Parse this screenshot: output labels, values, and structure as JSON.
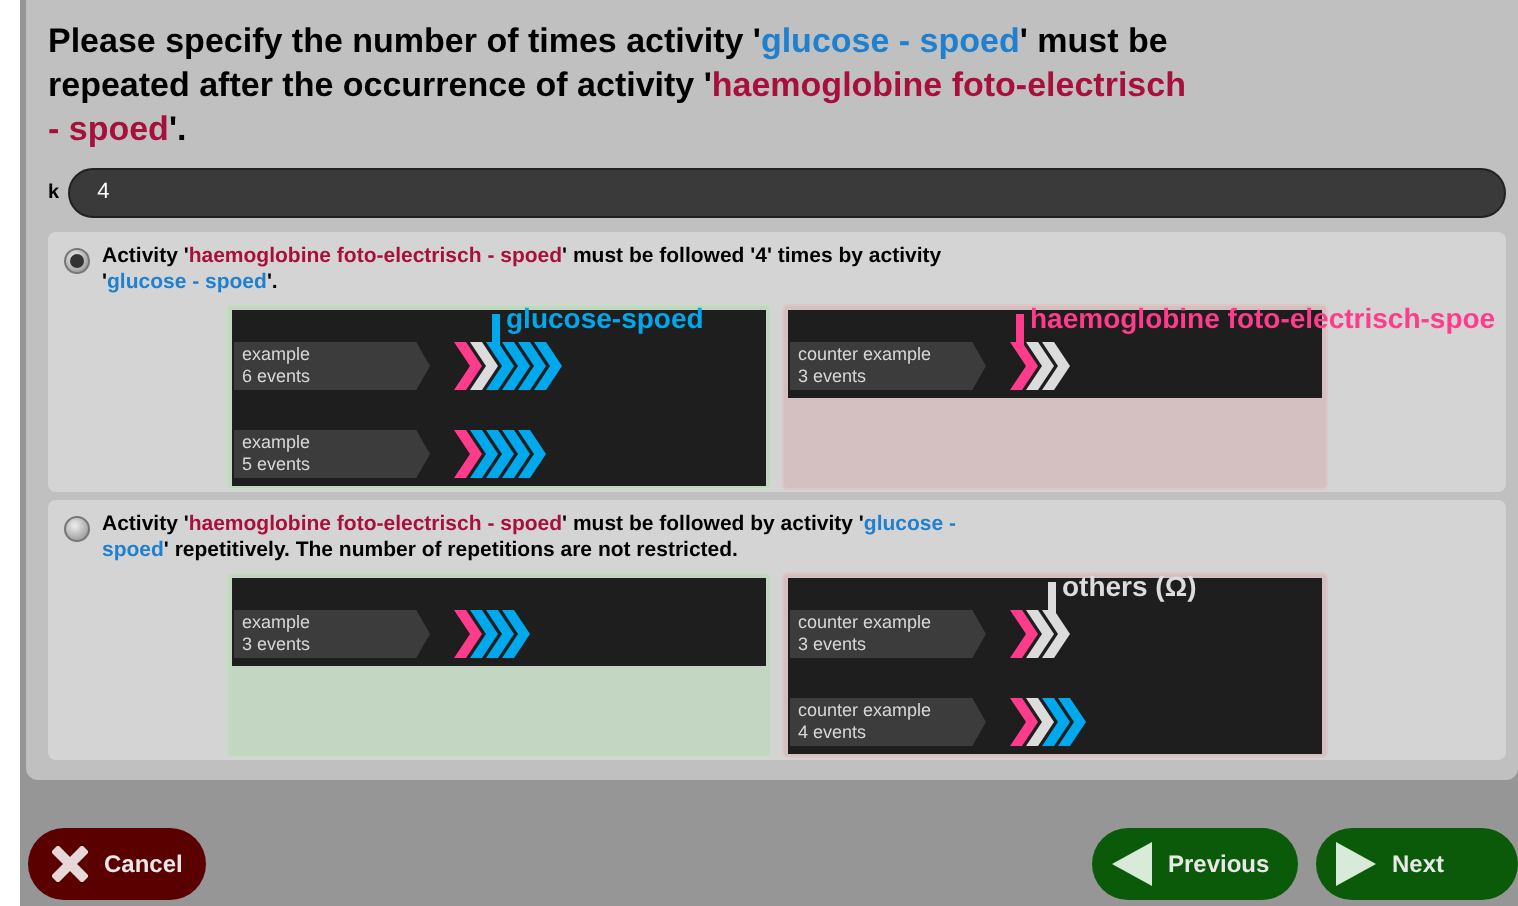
{
  "question": [
    {
      "kind": "plain",
      "text": "Please specify the number of times activity '"
    },
    {
      "kind": "target",
      "text": "glucose - spoed"
    },
    {
      "kind": "plain",
      "text": "' must be repeated after the occurrence of activity '"
    },
    {
      "kind": "source",
      "text": "haemoglobine foto-electrisch - spoed"
    },
    {
      "kind": "plain",
      "text": "'."
    }
  ],
  "field": {
    "label": "k",
    "value": "4"
  },
  "options": [
    {
      "selected": true,
      "sentence": [
        {
          "kind": "plain",
          "text": "Activity '"
        },
        {
          "kind": "source",
          "text": "haemoglobine foto-electrisch - spoed"
        },
        {
          "kind": "plain",
          "text": "' must be followed '4' times by activity '"
        },
        {
          "kind": "target",
          "text": "glucose - spoed"
        },
        {
          "kind": "plain",
          "text": "'."
        }
      ],
      "examples": [
        {
          "title": "example",
          "count": "6 events",
          "events": [
            {
              "kind": "source"
            },
            {
              "kind": "other"
            },
            {
              "kind": "target",
              "annotation": "glucose-spoed"
            },
            {
              "kind": "target"
            },
            {
              "kind": "target"
            },
            {
              "kind": "target"
            }
          ]
        },
        {
          "title": "example",
          "count": "5 events",
          "events": [
            {
              "kind": "source"
            },
            {
              "kind": "target"
            },
            {
              "kind": "target"
            },
            {
              "kind": "target"
            },
            {
              "kind": "target"
            }
          ]
        }
      ],
      "counter_examples": [
        {
          "title": "counter example",
          "count": "3 events",
          "events": [
            {
              "kind": "source",
              "annotation": "haemoglobine foto-electrisch-spoe"
            },
            {
              "kind": "other"
            },
            {
              "kind": "other"
            }
          ]
        }
      ]
    },
    {
      "selected": false,
      "sentence": [
        {
          "kind": "plain",
          "text": "Activity '"
        },
        {
          "kind": "source",
          "text": "haemoglobine foto-electrisch - spoed"
        },
        {
          "kind": "plain",
          "text": "' must be followed by activity '"
        },
        {
          "kind": "target",
          "text": "glucose - spoed"
        },
        {
          "kind": "plain",
          "text": "' repetitively. The number of repetitions are not restricted."
        }
      ],
      "examples": [
        {
          "title": "example",
          "count": "3 events",
          "events": [
            {
              "kind": "source"
            },
            {
              "kind": "target"
            },
            {
              "kind": "target"
            },
            {
              "kind": "target"
            }
          ]
        }
      ],
      "counter_examples": [
        {
          "title": "counter example",
          "count": "3 events",
          "events": [
            {
              "kind": "source"
            },
            {
              "kind": "other"
            },
            {
              "kind": "other",
              "annotation": "others (Ω)"
            }
          ]
        },
        {
          "title": "counter example",
          "count": "4 events",
          "events": [
            {
              "kind": "source"
            },
            {
              "kind": "other"
            },
            {
              "kind": "target"
            },
            {
              "kind": "target"
            }
          ]
        }
      ]
    }
  ],
  "buttons": [
    {
      "kind": "cancel",
      "label": "Cancel"
    },
    {
      "kind": "previous",
      "label": "Previous"
    },
    {
      "kind": "next",
      "label": "Next"
    }
  ]
}
